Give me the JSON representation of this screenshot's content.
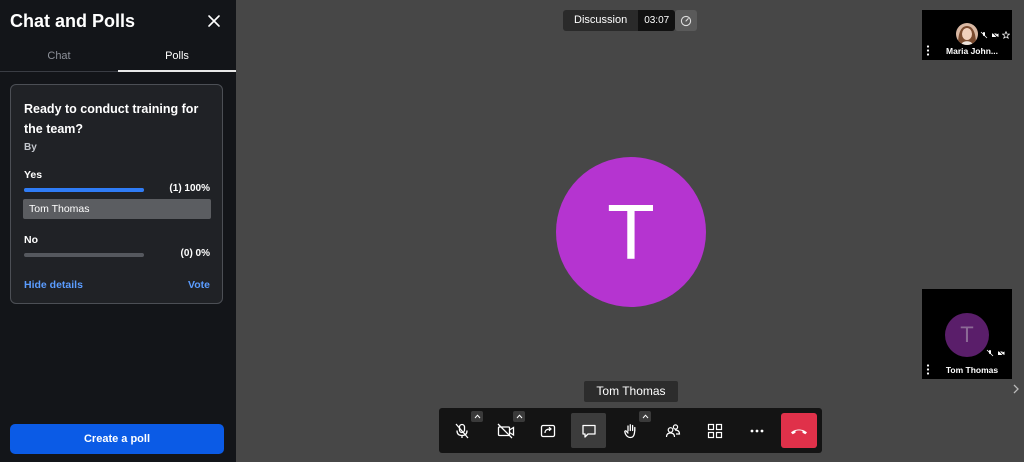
{
  "sidebar": {
    "title": "Chat and Polls",
    "tabs": [
      {
        "label": "Chat"
      },
      {
        "label": "Polls"
      }
    ],
    "poll": {
      "question": "Ready to conduct training for the team?",
      "by_label": "By",
      "options": [
        {
          "label": "Yes",
          "result": "(1) 100%",
          "fraction": 1.0,
          "voters": [
            "Tom Thomas"
          ]
        },
        {
          "label": "No",
          "result": "(0) 0%",
          "fraction": 0.0,
          "voters": []
        }
      ],
      "hide_details": "Hide details",
      "vote": "Vote"
    },
    "create_poll": "Create a poll"
  },
  "meeting": {
    "status_name": "Discussion",
    "timer": "03:07",
    "speaker": {
      "initial": "T",
      "name": "Tom Thomas",
      "color": "#b534d0"
    }
  },
  "participants": [
    {
      "name": "Maria John...",
      "has_photo": true
    },
    {
      "name": "Tom Thomas",
      "initial": "T"
    }
  ],
  "toolbar": {
    "buttons": [
      "mic-muted",
      "camera-off",
      "share-screen",
      "chat",
      "raise-hand",
      "participants",
      "tile-view",
      "more",
      "hangup"
    ]
  },
  "colors": {
    "accent": "#0b5be6",
    "link": "#5a9cff",
    "hangup": "#e0314a",
    "avatar": "#b534d0"
  }
}
